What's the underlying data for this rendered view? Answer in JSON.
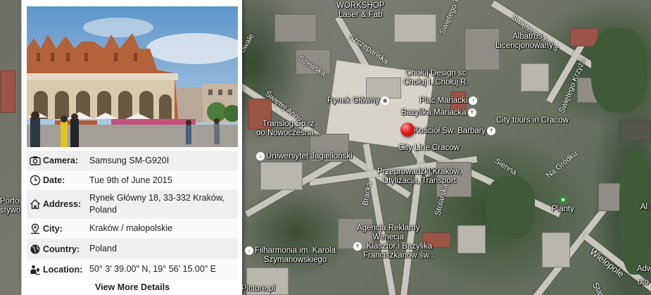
{
  "map": {
    "labels": {
      "workshop": "WORKSHOP\nLaser & Fab",
      "swietego_marka": "Świętego Marka",
      "swietego_tomasza": "Świętego Tomasza",
      "szczepanska": "Szczepańska",
      "szewska": "Szewska",
      "albatros": "Albatros\nLicencjonowany...",
      "swietego_krzyza": "Świętego Krzyża",
      "choluj": "Chołuj Design sc\nChołuj I, Chołuj R.",
      "rynek_glowny": "Rynek Główny",
      "plac_mariacki": "Plac Mariacki",
      "swietej_anny": "Świętej Anny",
      "bazylika": "Bazylika Mariacka",
      "translog": "Translog Sp. z\noo Nowoczesna...",
      "kosciol": "Kościół Św. Barbary",
      "city_tours": "City tours in Cracow",
      "city_line": "City Line Cracow",
      "uniwersytet": "Uniwersytet Jagielloński",
      "sienna": "Sienna",
      "na_gródku": "Na Gródku",
      "przeprowadzki": "Przeprowadzki Kraków,\nUtylizacja, Transport",
      "bracka": "Bracka",
      "stolarska": "Stolarska",
      "planty": "Planty",
      "agencja": "Agencja Reklamy\nWenecja",
      "klasztor": "Klasztor i Bazylika\nFranciszkanów św...",
      "wielopole": "Wielopole",
      "filharmonia": "Filharmonia im. Karola\nSzymanowskiego",
      "picture": "Picture.pl",
      "portow": "Portow\nstywo",
      "al": "Al",
      "adw": "Adw",
      "oto": "oto",
      "staro": "Staro",
      "owale": "owale"
    }
  },
  "panel": {
    "rows": [
      {
        "label": "Camera:",
        "value": "Samsung SM-G920I",
        "icon": "camera-icon"
      },
      {
        "label": "Date:",
        "value": "Tue 9th of June 2015",
        "icon": "clock-icon"
      },
      {
        "label": "Address:",
        "value": "Rynek Główny 18, 33-332 Kraków, Poland",
        "icon": "home-icon"
      },
      {
        "label": "City:",
        "value": "Kraków / małopolskie",
        "icon": "location-pin-icon"
      },
      {
        "label": "Country:",
        "value": "Poland",
        "icon": "globe-icon"
      },
      {
        "label": "Location:",
        "value": "50° 3' 39.00\" N, 19° 56' 15.00\" E",
        "icon": "map-pin-person-icon"
      }
    ],
    "more_button": "View More Details"
  },
  "colors": {
    "marker": "#e31b1b",
    "panel_bg": "#ffffff",
    "row_bg": "#efefef"
  }
}
